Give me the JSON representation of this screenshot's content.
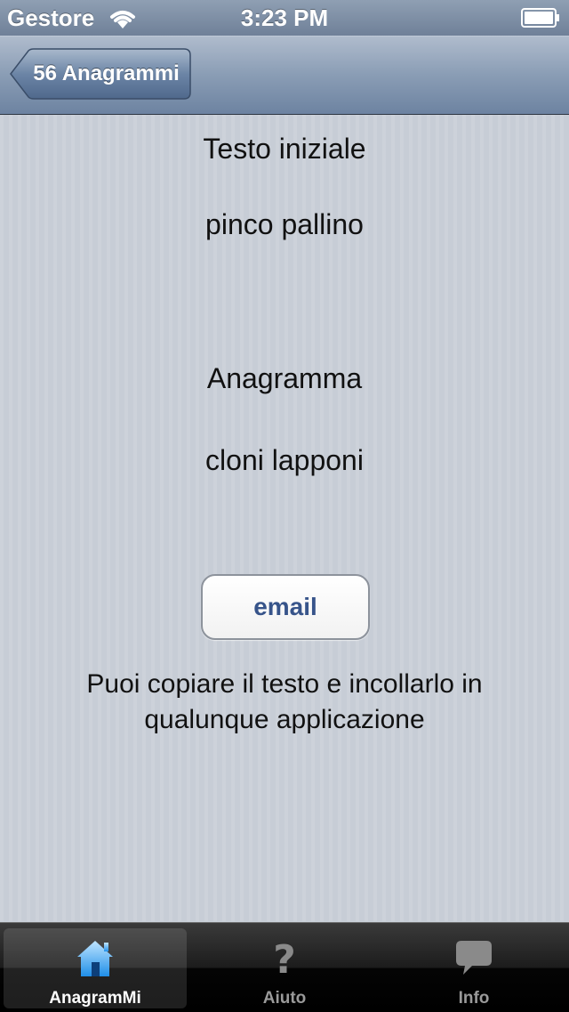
{
  "status_bar": {
    "carrier": "Gestore",
    "time": "3:23 PM",
    "wifi_icon": "wifi-icon",
    "battery_icon": "battery-icon"
  },
  "nav_bar": {
    "back_label": "56 Anagrammi"
  },
  "content": {
    "initial_label": "Testo iniziale",
    "initial_value": "pinco pallino",
    "anagram_label": "Anagramma",
    "anagram_value": "cloni lapponi",
    "email_button": "email",
    "hint": "Puoi copiare il testo e incollarlo in qualunque applicazione"
  },
  "tab_bar": {
    "tabs": [
      {
        "label": "AnagramMi",
        "icon": "home-icon",
        "active": true
      },
      {
        "label": "Aiuto",
        "icon": "question-icon",
        "active": false
      },
      {
        "label": "Info",
        "icon": "speech-bubble-icon",
        "active": false
      }
    ]
  },
  "colors": {
    "accent": "#37548a",
    "nav_bar": "#6d83a1",
    "background": "#c7cdd6"
  }
}
